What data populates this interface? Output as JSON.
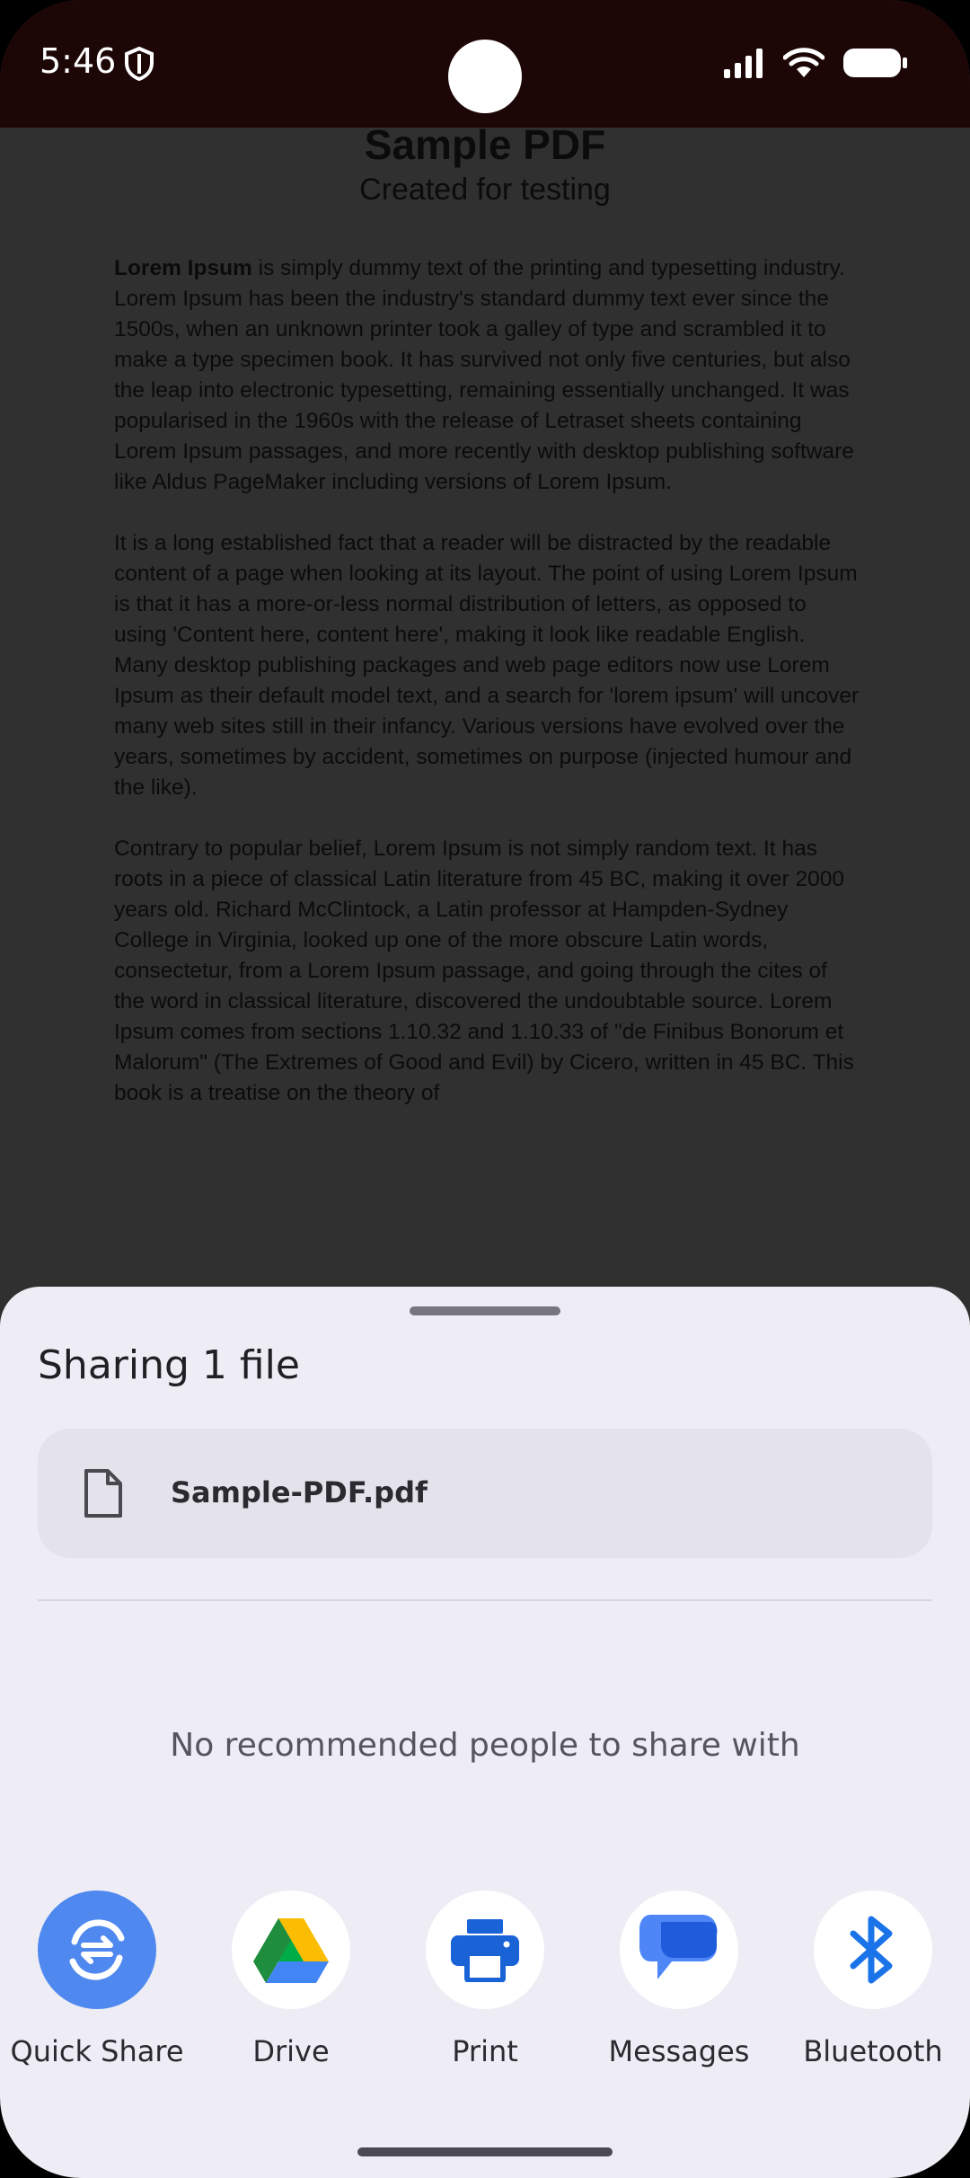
{
  "status_bar": {
    "time": "5:46",
    "icons": [
      "shield-icon",
      "signal-icon",
      "wifi-icon",
      "battery-icon"
    ]
  },
  "document": {
    "title": "Sample PDF",
    "subtitle": "Created for testing",
    "paragraphs": [
      {
        "bold_lead": "Lorem Ipsum",
        "text": " is simply dummy text of the printing and typesetting industry. Lorem Ipsum has been the industry's standard dummy text ever since the 1500s, when an unknown printer took a galley of type and scrambled it to make a type specimen book. It has survived not only five centuries, but also the leap into electronic typesetting, remaining essentially unchanged. It was popularised in the 1960s with the release of Letraset sheets containing Lorem Ipsum passages, and more recently with desktop publishing software like Aldus PageMaker including versions of Lorem Ipsum."
      },
      {
        "text": "It is a long established fact that a reader will be distracted by the readable content of a page when looking at its layout. The point of using Lorem Ipsum is that it has a more-or-less normal distribution of letters, as opposed to using 'Content here, content here', making it look like readable English. Many desktop publishing packages and web page editors now use Lorem Ipsum as their default model text, and a search for 'lorem ipsum' will uncover many web sites still in their infancy. Various versions have evolved over the years, sometimes by accident, sometimes on purpose (injected humour and the like)."
      },
      {
        "text": "Contrary to popular belief, Lorem Ipsum is not simply random text. It has roots in a piece of classical Latin literature from 45 BC, making it over 2000 years old. Richard McClintock, a Latin professor at Hampden-Sydney College in Virginia, looked up one of the more obscure Latin words, consectetur, from a Lorem Ipsum passage, and going through the cites of the word in classical literature, discovered the undoubtable source. Lorem Ipsum comes from sections 1.10.32 and 1.10.33 of \"de Finibus Bonorum et Malorum\" (The Extremes of Good and Evil) by Cicero, written in 45 BC. This book is a treatise on the theory of"
      }
    ]
  },
  "share_sheet": {
    "title": "Sharing 1 file",
    "file": {
      "name": "Sample-PDF.pdf",
      "icon": "file-icon"
    },
    "no_people_text": "No recommended people to share with",
    "apps": [
      {
        "label": "Quick Share",
        "icon": "quick-share-icon",
        "color": "#4f88ef"
      },
      {
        "label": "Drive",
        "icon": "drive-icon"
      },
      {
        "label": "Print",
        "icon": "print-icon",
        "color": "#1a63d6"
      },
      {
        "label": "Messages",
        "icon": "messages-icon",
        "color": "#1a63d6"
      },
      {
        "label": "Bluetooth",
        "icon": "bluetooth-icon",
        "color": "#1a73e8"
      }
    ]
  }
}
